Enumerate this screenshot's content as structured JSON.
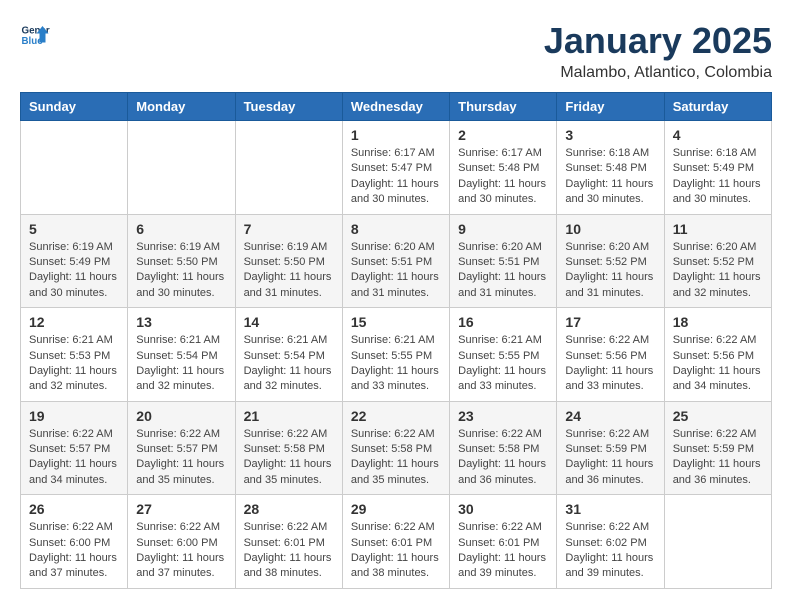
{
  "logo": {
    "line1": "General",
    "line2": "Blue"
  },
  "header": {
    "title": "January 2025",
    "subtitle": "Malambo, Atlantico, Colombia"
  },
  "weekdays": [
    "Sunday",
    "Monday",
    "Tuesday",
    "Wednesday",
    "Thursday",
    "Friday",
    "Saturday"
  ],
  "weeks": [
    [
      {
        "day": "",
        "info": ""
      },
      {
        "day": "",
        "info": ""
      },
      {
        "day": "",
        "info": ""
      },
      {
        "day": "1",
        "info": "Sunrise: 6:17 AM\nSunset: 5:47 PM\nDaylight: 11 hours\nand 30 minutes."
      },
      {
        "day": "2",
        "info": "Sunrise: 6:17 AM\nSunset: 5:48 PM\nDaylight: 11 hours\nand 30 minutes."
      },
      {
        "day": "3",
        "info": "Sunrise: 6:18 AM\nSunset: 5:48 PM\nDaylight: 11 hours\nand 30 minutes."
      },
      {
        "day": "4",
        "info": "Sunrise: 6:18 AM\nSunset: 5:49 PM\nDaylight: 11 hours\nand 30 minutes."
      }
    ],
    [
      {
        "day": "5",
        "info": "Sunrise: 6:19 AM\nSunset: 5:49 PM\nDaylight: 11 hours\nand 30 minutes."
      },
      {
        "day": "6",
        "info": "Sunrise: 6:19 AM\nSunset: 5:50 PM\nDaylight: 11 hours\nand 30 minutes."
      },
      {
        "day": "7",
        "info": "Sunrise: 6:19 AM\nSunset: 5:50 PM\nDaylight: 11 hours\nand 31 minutes."
      },
      {
        "day": "8",
        "info": "Sunrise: 6:20 AM\nSunset: 5:51 PM\nDaylight: 11 hours\nand 31 minutes."
      },
      {
        "day": "9",
        "info": "Sunrise: 6:20 AM\nSunset: 5:51 PM\nDaylight: 11 hours\nand 31 minutes."
      },
      {
        "day": "10",
        "info": "Sunrise: 6:20 AM\nSunset: 5:52 PM\nDaylight: 11 hours\nand 31 minutes."
      },
      {
        "day": "11",
        "info": "Sunrise: 6:20 AM\nSunset: 5:52 PM\nDaylight: 11 hours\nand 32 minutes."
      }
    ],
    [
      {
        "day": "12",
        "info": "Sunrise: 6:21 AM\nSunset: 5:53 PM\nDaylight: 11 hours\nand 32 minutes."
      },
      {
        "day": "13",
        "info": "Sunrise: 6:21 AM\nSunset: 5:54 PM\nDaylight: 11 hours\nand 32 minutes."
      },
      {
        "day": "14",
        "info": "Sunrise: 6:21 AM\nSunset: 5:54 PM\nDaylight: 11 hours\nand 32 minutes."
      },
      {
        "day": "15",
        "info": "Sunrise: 6:21 AM\nSunset: 5:55 PM\nDaylight: 11 hours\nand 33 minutes."
      },
      {
        "day": "16",
        "info": "Sunrise: 6:21 AM\nSunset: 5:55 PM\nDaylight: 11 hours\nand 33 minutes."
      },
      {
        "day": "17",
        "info": "Sunrise: 6:22 AM\nSunset: 5:56 PM\nDaylight: 11 hours\nand 33 minutes."
      },
      {
        "day": "18",
        "info": "Sunrise: 6:22 AM\nSunset: 5:56 PM\nDaylight: 11 hours\nand 34 minutes."
      }
    ],
    [
      {
        "day": "19",
        "info": "Sunrise: 6:22 AM\nSunset: 5:57 PM\nDaylight: 11 hours\nand 34 minutes."
      },
      {
        "day": "20",
        "info": "Sunrise: 6:22 AM\nSunset: 5:57 PM\nDaylight: 11 hours\nand 35 minutes."
      },
      {
        "day": "21",
        "info": "Sunrise: 6:22 AM\nSunset: 5:58 PM\nDaylight: 11 hours\nand 35 minutes."
      },
      {
        "day": "22",
        "info": "Sunrise: 6:22 AM\nSunset: 5:58 PM\nDaylight: 11 hours\nand 35 minutes."
      },
      {
        "day": "23",
        "info": "Sunrise: 6:22 AM\nSunset: 5:58 PM\nDaylight: 11 hours\nand 36 minutes."
      },
      {
        "day": "24",
        "info": "Sunrise: 6:22 AM\nSunset: 5:59 PM\nDaylight: 11 hours\nand 36 minutes."
      },
      {
        "day": "25",
        "info": "Sunrise: 6:22 AM\nSunset: 5:59 PM\nDaylight: 11 hours\nand 36 minutes."
      }
    ],
    [
      {
        "day": "26",
        "info": "Sunrise: 6:22 AM\nSunset: 6:00 PM\nDaylight: 11 hours\nand 37 minutes."
      },
      {
        "day": "27",
        "info": "Sunrise: 6:22 AM\nSunset: 6:00 PM\nDaylight: 11 hours\nand 37 minutes."
      },
      {
        "day": "28",
        "info": "Sunrise: 6:22 AM\nSunset: 6:01 PM\nDaylight: 11 hours\nand 38 minutes."
      },
      {
        "day": "29",
        "info": "Sunrise: 6:22 AM\nSunset: 6:01 PM\nDaylight: 11 hours\nand 38 minutes."
      },
      {
        "day": "30",
        "info": "Sunrise: 6:22 AM\nSunset: 6:01 PM\nDaylight: 11 hours\nand 39 minutes."
      },
      {
        "day": "31",
        "info": "Sunrise: 6:22 AM\nSunset: 6:02 PM\nDaylight: 11 hours\nand 39 minutes."
      },
      {
        "day": "",
        "info": ""
      }
    ]
  ]
}
